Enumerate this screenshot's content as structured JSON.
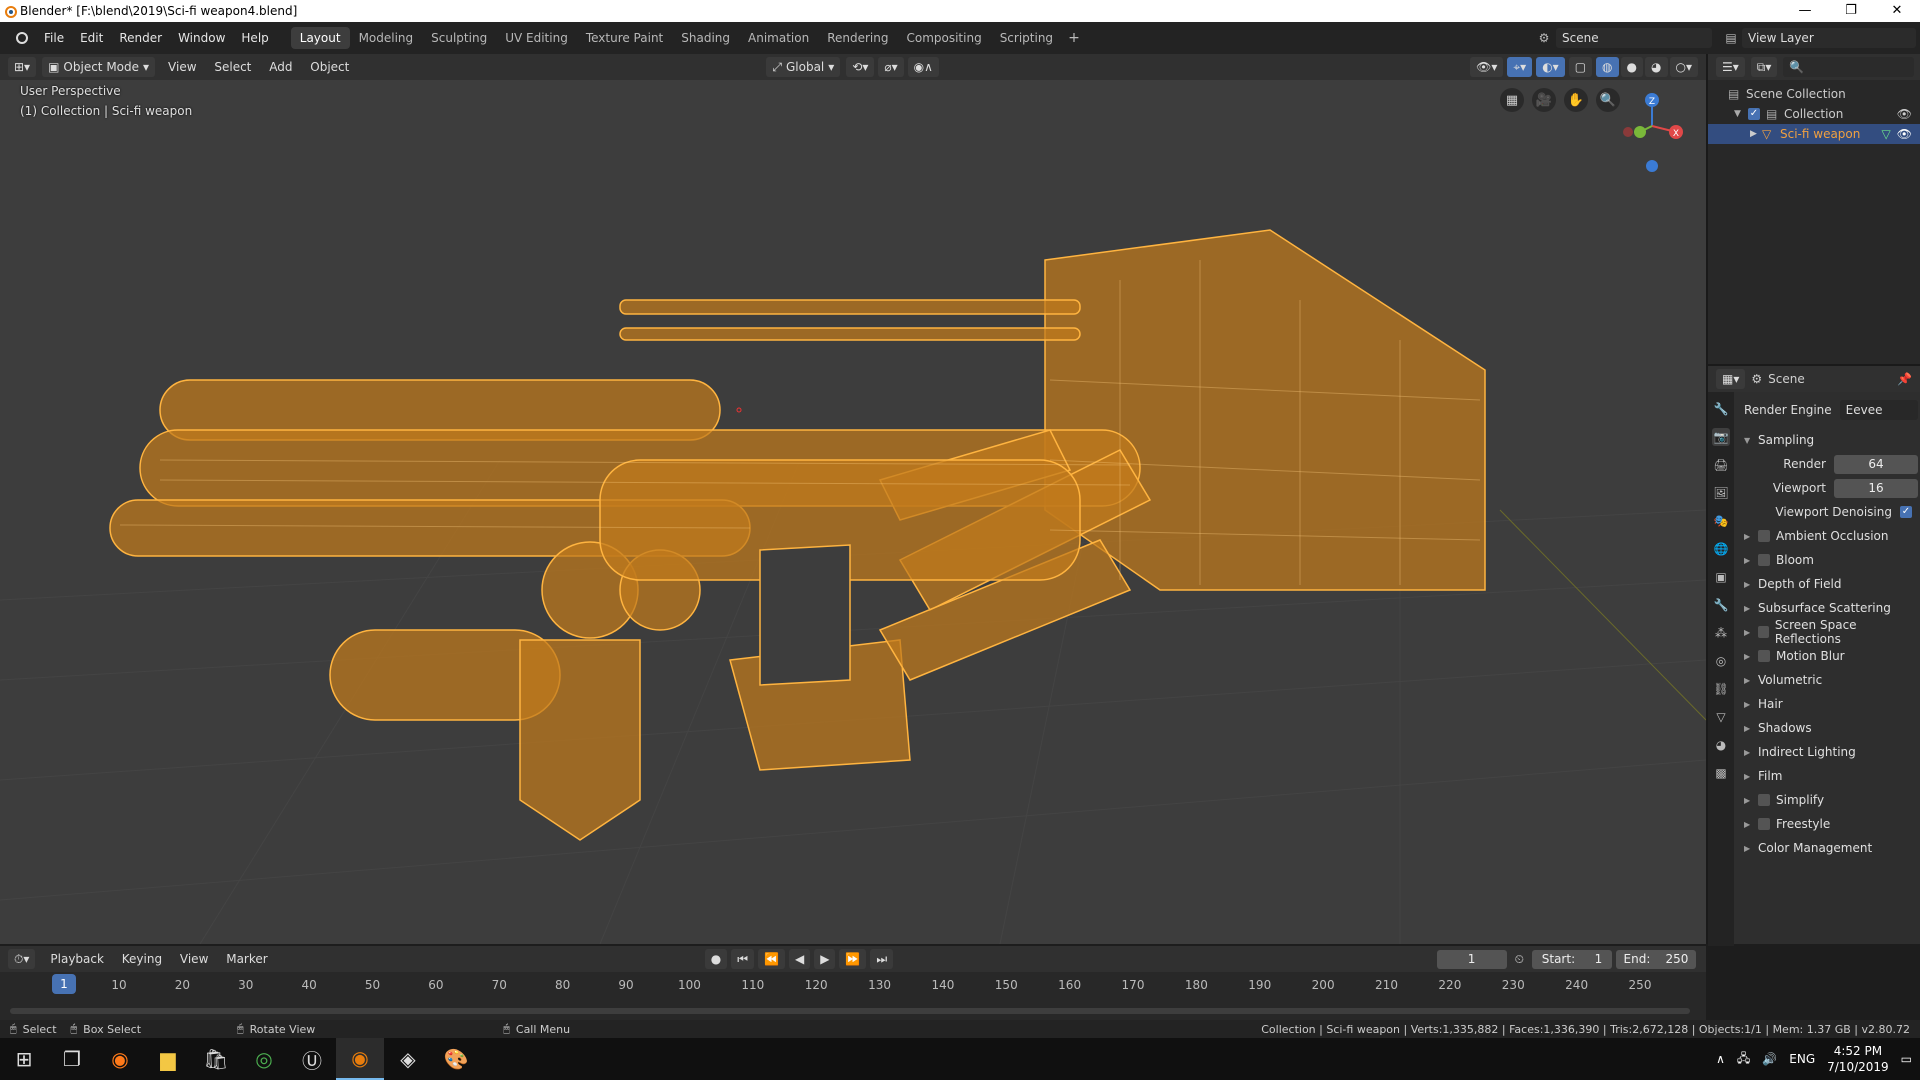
{
  "window": {
    "title": "Blender* [F:\\blend\\2019\\Sci-fi weapon4.blend]",
    "min": "—",
    "max": "❐",
    "close": "✕"
  },
  "menus": [
    "File",
    "Edit",
    "Render",
    "Window",
    "Help"
  ],
  "workspaces": [
    "Layout",
    "Modeling",
    "Sculpting",
    "UV Editing",
    "Texture Paint",
    "Shading",
    "Animation",
    "Rendering",
    "Compositing",
    "Scripting"
  ],
  "workspace_add": "+",
  "scene": {
    "name": "Scene"
  },
  "view_layer": {
    "name": "View Layer"
  },
  "viewport_header": {
    "mode": "Object Mode",
    "menus": [
      "View",
      "Select",
      "Add",
      "Object"
    ],
    "orientation": "Global"
  },
  "viewport": {
    "perspective": "User Perspective",
    "context": "(1) Collection | Sci-fi weapon",
    "axes": {
      "x": "X",
      "y": "Y",
      "z": "Z"
    }
  },
  "outliner": {
    "rows": [
      "Scene Collection",
      "Collection",
      "Sci-fi weapon"
    ]
  },
  "properties": {
    "title": "Scene",
    "render_engine_label": "Render Engine",
    "render_engine": "Eevee",
    "sampling": "Sampling",
    "render_label": "Render",
    "render_value": "64",
    "viewport_label": "Viewport",
    "viewport_value": "16",
    "denoise_label": "Viewport Denoising",
    "panels": [
      {
        "label": "Ambient Occlusion",
        "check": true
      },
      {
        "label": "Bloom",
        "check": true
      },
      {
        "label": "Depth of Field",
        "check": false
      },
      {
        "label": "Subsurface Scattering",
        "check": false
      },
      {
        "label": "Screen Space Reflections",
        "check": true
      },
      {
        "label": "Motion Blur",
        "check": true
      },
      {
        "label": "Volumetric",
        "check": false
      },
      {
        "label": "Hair",
        "check": false
      },
      {
        "label": "Shadows",
        "check": false
      },
      {
        "label": "Indirect Lighting",
        "check": false
      },
      {
        "label": "Film",
        "check": false
      },
      {
        "label": "Simplify",
        "check": true
      },
      {
        "label": "Freestyle",
        "check": true
      },
      {
        "label": "Color Management",
        "check": false
      }
    ]
  },
  "timeline": {
    "menus": [
      "Playback",
      "Keying",
      "View",
      "Marker"
    ],
    "current_frame": "1",
    "start_label": "Start:",
    "start": "1",
    "end_label": "End:",
    "end": "250",
    "ruler": [
      "1",
      "10",
      "20",
      "30",
      "40",
      "50",
      "60",
      "70",
      "80",
      "90",
      "100",
      "110",
      "120",
      "130",
      "140",
      "150",
      "160",
      "170",
      "180",
      "190",
      "200",
      "210",
      "220",
      "230",
      "240",
      "250"
    ]
  },
  "status": {
    "select": "Select",
    "box_select": "Box Select",
    "rotate": "Rotate View",
    "call_menu": "Call Menu",
    "info": "Collection | Sci-fi weapon | Verts:1,335,882 | Faces:1,336,390 | Tris:2,672,128 | Objects:1/1 | Mem: 1.37 GB | v2.80.72"
  },
  "taskbar": {
    "lang": "ENG",
    "time": "4:52 PM",
    "date": "7/10/2019"
  },
  "colors": {
    "wire": "#e89a2c",
    "accent": "#4772b3",
    "selected": "#334d80"
  }
}
